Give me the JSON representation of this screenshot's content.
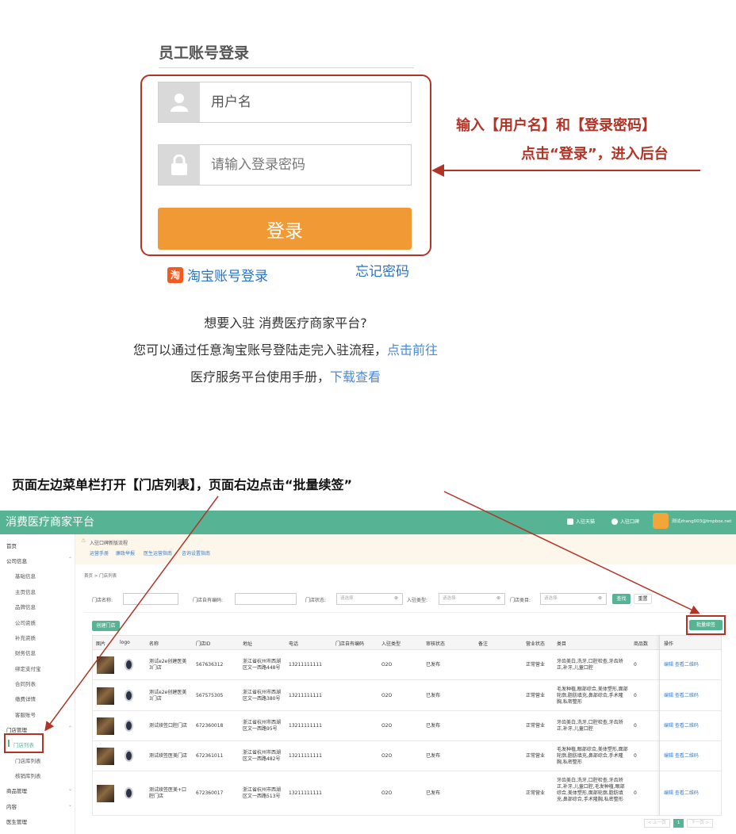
{
  "login": {
    "title": "员工账号登录",
    "username_placeholder": "用户名",
    "password_placeholder": "请输入登录密码",
    "login_button": "登录",
    "taobao_login": "淘宝账号登录",
    "taobao_icon_glyph": "淘",
    "forgot_password": "忘记密码"
  },
  "annotation1": {
    "line1": "输入【用户名】和【登录密码】",
    "line2": "点击“登录”，进入后台"
  },
  "join": {
    "question": "想要入驻 消费医疗商家平台?",
    "line2_text": "您可以通过任意淘宝账号登陆走完入驻流程，",
    "line2_link": "点击前往",
    "line3_text": "医疗服务平台使用手册，",
    "line3_link": "下载查看"
  },
  "annotation2": {
    "text": "页面左边菜单栏打开【门店列表】，页面右边点击“批量续签”"
  },
  "app": {
    "title": "消费医疗商家平台",
    "header_items": [
      "入驻天猫",
      "入驻口碑"
    ],
    "user": "测试zhang003@tmpbox.net",
    "sidebar": [
      {
        "label": "首页",
        "level": 1
      },
      {
        "label": "公司信息",
        "level": 1,
        "caret": "^"
      },
      {
        "label": "基础信息",
        "level": 2
      },
      {
        "label": "主页信息",
        "level": 2
      },
      {
        "label": "品牌信息",
        "level": 2
      },
      {
        "label": "公司资质",
        "level": 2
      },
      {
        "label": "补充资质",
        "level": 2
      },
      {
        "label": "财务信息",
        "level": 2
      },
      {
        "label": "绑定支付宝",
        "level": 2
      },
      {
        "label": "合同列表",
        "level": 2
      },
      {
        "label": "缴费详情",
        "level": 2
      },
      {
        "label": "客服账号",
        "level": 2
      },
      {
        "label": "门店管理",
        "level": 1,
        "caret": "^"
      },
      {
        "label": "门店列表",
        "level": 2,
        "active": true
      },
      {
        "label": "门店库列表",
        "level": 2
      },
      {
        "label": "核销库列表",
        "level": 2
      },
      {
        "label": "商品管理",
        "level": 1,
        "caret": "v"
      },
      {
        "label": "内容",
        "level": 1,
        "caret": "v"
      },
      {
        "label": "医生管理",
        "level": 1
      }
    ],
    "notice": {
      "title": "入驻口碑新版流程",
      "links": [
        "运营手册",
        "廉政举报",
        "医生运营指南",
        "咨询设置指南"
      ]
    },
    "breadcrumb": "首页 > 门店列表",
    "filters": {
      "store_name_label": "门店名称:",
      "store_code_label": "门店自有编码:",
      "store_status_label": "门店状态:",
      "join_type_label": "入驻类型:",
      "category_label": "门店类目:",
      "placeholder": "请选择",
      "search": "查找",
      "reset": "重置"
    },
    "create_button": "创建门店",
    "batch_button": "批量续签",
    "table": {
      "columns": [
        "图片",
        "logo",
        "名称",
        "门店ID",
        "地址",
        "电话",
        "门店自有编码",
        "入驻类型",
        "审核状态",
        "备注",
        "营业状态",
        "类目",
        "商品数",
        "操作"
      ],
      "rows": [
        {
          "name": "测试e2e创建医美3门店",
          "id": "567636312",
          "address": "浙江省杭州市西湖区文一西路448号",
          "phone": "13211111111",
          "code": "",
          "type": "O2O",
          "audit": "已发布",
          "note": "",
          "status": "正常营业",
          "category": "牙齿美白,洗牙,口腔检查,牙齿矫正,补牙,儿童口腔",
          "goods": "0",
          "ops": "编辑 查看二维码"
        },
        {
          "name": "测试e2e创建医美3门店",
          "id": "567575305",
          "address": "浙江省杭州市西湖区文一西路380号",
          "phone": "13211111111",
          "code": "",
          "type": "O2O",
          "audit": "已发布",
          "note": "",
          "status": "正常营业",
          "category": "毛发种植,眼部综合,美体塑形,面部轮廓,脂肪填充,鼻部综合,手术隆胸,私密整形",
          "goods": "0",
          "ops": "编辑 查看二维码"
        },
        {
          "name": "测试续签口腔门店",
          "id": "672360018",
          "address": "浙江省杭州市西湖区文一西路95号",
          "phone": "13211111111",
          "code": "",
          "type": "O2O",
          "audit": "已发布",
          "note": "",
          "status": "正常营业",
          "category": "牙齿美白,洗牙,口腔检查,牙齿矫正,补牙,儿童口腔",
          "goods": "0",
          "ops": "编辑 查看二维码"
        },
        {
          "name": "测试续签医美门店",
          "id": "672361011",
          "address": "浙江省杭州市西湖区文一西路482号",
          "phone": "13211111111",
          "code": "",
          "type": "O2O",
          "audit": "已发布",
          "note": "",
          "status": "正常营业",
          "category": "毛发种植,眼部综合,美体塑形,面部轮廓,脂肪填充,鼻部综合,手术隆胸,私密整形",
          "goods": "0",
          "ops": "编辑 查看二维码"
        },
        {
          "name": "测试续签医美+口腔门店",
          "id": "672360017",
          "address": "浙江省杭州市西湖区文一西路513号",
          "phone": "13211111111",
          "code": "",
          "type": "O2O",
          "audit": "已发布",
          "note": "",
          "status": "正常营业",
          "category": "牙齿美白,洗牙,口腔检查,牙齿矫正,补牙,儿童口腔,毛发种植,眼部综合,美体塑形,面部轮廓,脂肪填充,鼻部综合,手术隆胸,私密整形",
          "goods": "0",
          "ops": "编辑 查看二维码"
        }
      ]
    },
    "pager": {
      "prev": "< 上一页",
      "current": "1",
      "next": "下一页 >"
    }
  },
  "colors": {
    "brand": "#56b495",
    "annotation": "#b23427",
    "login_button": "#f19a35",
    "link": "#2b73c4"
  }
}
